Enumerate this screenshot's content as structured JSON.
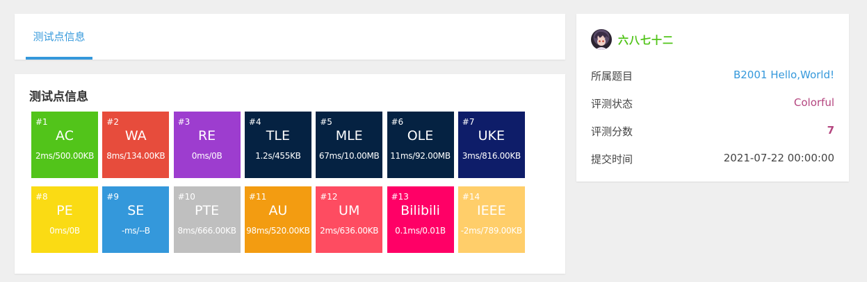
{
  "tabs": [
    {
      "label": "测试点信息"
    }
  ],
  "cases_title": "测试点信息",
  "cases": [
    {
      "num": "#1",
      "status": "AC",
      "meta": "2ms/500.00KB",
      "color": "#52c41a"
    },
    {
      "num": "#2",
      "status": "WA",
      "meta": "8ms/134.00KB",
      "color": "#e74c3c"
    },
    {
      "num": "#3",
      "status": "RE",
      "meta": "0ms/0B",
      "color": "#9d3dcf"
    },
    {
      "num": "#4",
      "status": "TLE",
      "meta": "1.2s/455KB",
      "color": "#052242"
    },
    {
      "num": "#5",
      "status": "MLE",
      "meta": "67ms/10.00MB",
      "color": "#052242"
    },
    {
      "num": "#6",
      "status": "OLE",
      "meta": "11ms/92.00MB",
      "color": "#052242"
    },
    {
      "num": "#7",
      "status": "UKE",
      "meta": "3ms/816.00KB",
      "color": "#0e1d69"
    },
    {
      "num": "#8",
      "status": "PE",
      "meta": "0ms/0B",
      "color": "#fadb14"
    },
    {
      "num": "#9",
      "status": "SE",
      "meta": "-ms/--B",
      "color": "#3498db"
    },
    {
      "num": "#10",
      "status": "PTE",
      "meta": "8ms/666.00KB",
      "color": "#bfbfbf"
    },
    {
      "num": "#11",
      "status": "AU",
      "meta": "98ms/520.00KB",
      "color": "#f39c11"
    },
    {
      "num": "#12",
      "status": "UM",
      "meta": "2ms/636.00KB",
      "color": "#fe4c61"
    },
    {
      "num": "#13",
      "status": "Bilibili",
      "meta": "0.1ms/0.01B",
      "color": "#ff0066"
    },
    {
      "num": "#14",
      "status": "IEEE",
      "meta": "-2ms/789.00KB",
      "color": "#ffce6a"
    }
  ],
  "user": {
    "name": "六八七十二",
    "avatar_icon": "anime-avatar"
  },
  "info": [
    {
      "label": "所属题目",
      "value": "B2001 Hello,World!",
      "color": "#3498db"
    },
    {
      "label": "评测状态",
      "value": "Colorful",
      "color": "#b4457f"
    },
    {
      "label": "评测分数",
      "value": "7",
      "color": "#b4457f",
      "bold": true
    },
    {
      "label": "提交时间",
      "value": "2021-07-22 00:00:00",
      "color": "#444"
    }
  ]
}
